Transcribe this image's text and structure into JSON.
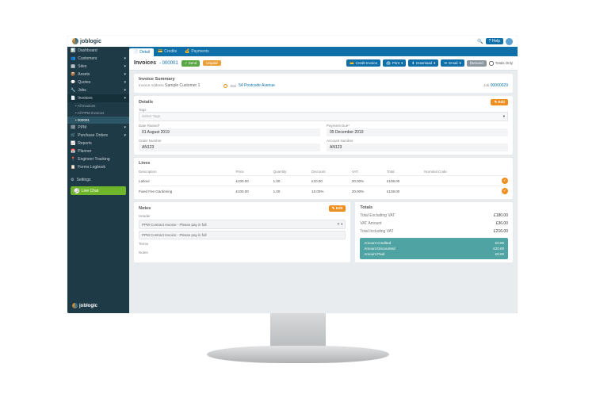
{
  "brand": "joblogic",
  "topbar": {
    "search": "?",
    "help": "? Help"
  },
  "sidebar": {
    "items": [
      {
        "label": "Dashboard"
      },
      {
        "label": "Customers"
      },
      {
        "label": "Sites"
      },
      {
        "label": "Assets"
      },
      {
        "label": "Quotes"
      },
      {
        "label": "Jobs"
      },
      {
        "label": "Invoices",
        "expanded": true
      },
      {
        "label": "PPM"
      },
      {
        "label": "Purchase Orders"
      },
      {
        "label": "Reports"
      },
      {
        "label": "Planner"
      },
      {
        "label": "Engineer Tracking"
      },
      {
        "label": "Forms Logbook"
      }
    ],
    "subitems": [
      {
        "label": "All Invoices"
      },
      {
        "label": "All PPM Invoices"
      },
      {
        "label": "000001",
        "active": true
      }
    ],
    "settings": "Settings",
    "livechat": "Live Chat"
  },
  "tabs": [
    {
      "label": "Detail",
      "active": true
    },
    {
      "label": "Credits"
    },
    {
      "label": "Payments"
    }
  ],
  "header": {
    "title": "Invoices",
    "id": "- 000001",
    "badge1": "✓ Send",
    "badge2": "Unpaid",
    "btns": {
      "credit": "Credit Invoice",
      "print": "Print",
      "download": "Download",
      "email": "Email",
      "demand": "Demand",
      "totals": "Totals Only"
    }
  },
  "summary": {
    "title": "Invoice Summary",
    "addr_lbl": "Invoice Address",
    "addr_val": "Sample Customer 1",
    "site_lbl": "Site",
    "site_val": "54 Postcode Avenue",
    "job_lbl": "Job",
    "job_val": "00000029"
  },
  "details": {
    "title": "Details",
    "edit": "✎ Edit",
    "tags_lbl": "Tags",
    "tags_ph": "Select Tags",
    "date_raised_lbl": "Date Raised*",
    "date_raised_val": "01 August 2019",
    "payment_due_lbl": "Payment Due*",
    "payment_due_val": "05 December 2019",
    "order_num_lbl": "Order Number",
    "order_num_val": "AN123",
    "account_num_lbl": "Account Number",
    "account_num_val": "AN123"
  },
  "lines": {
    "title": "Lines",
    "cols": [
      "Description",
      "Price",
      "Quantity",
      "Discount",
      "VAT",
      "Total",
      "Nominal Code",
      ""
    ],
    "rows": [
      {
        "desc": "Labour",
        "price": "£100.00",
        "qty": "1.00",
        "disc": "£10.00",
        "vat": "20.00%",
        "total": "£108.00"
      },
      {
        "desc": "Fixed Fee Gardening",
        "price": "£100.00",
        "qty": "1.00",
        "disc": "10.00%",
        "vat": "20.00%",
        "total": "£108.00"
      }
    ]
  },
  "notes": {
    "title": "Notes",
    "edit": "✎ Edit",
    "header_lbl": "Header",
    "header_val": "PPM Contract Invoice - Please pay in full",
    "header_val2": "PPM Contract Invoice - Please pay in full",
    "terms_lbl": "Terms",
    "notes_lbl": "Notes"
  },
  "totals": {
    "title": "Totals",
    "rows": [
      {
        "l": "Total Excluding VAT",
        "v": "£180.00"
      },
      {
        "l": "VAT Amount",
        "v": "£36.00"
      },
      {
        "l": "Total Including VAT",
        "v": "£216.00"
      }
    ],
    "teal": [
      {
        "l": "Amount Credited",
        "v": "£0.00"
      },
      {
        "l": "Amount Discounted",
        "v": "£20.00"
      },
      {
        "l": "Amount Paid",
        "v": "£0.00"
      }
    ]
  }
}
